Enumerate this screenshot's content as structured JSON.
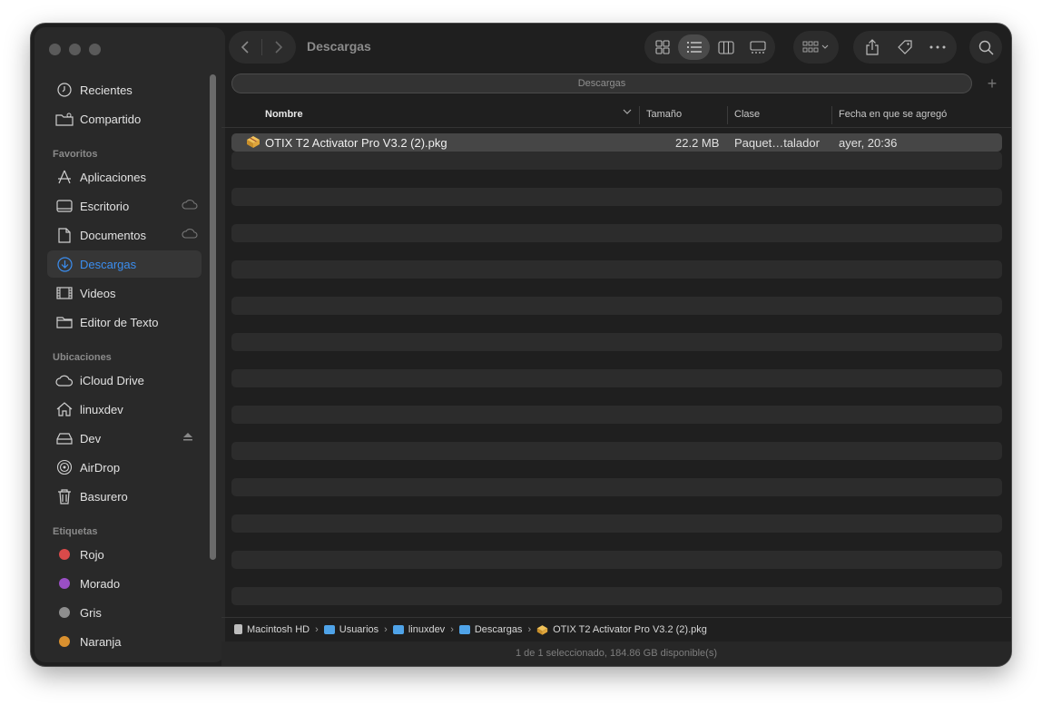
{
  "window": {
    "title": "Descargas"
  },
  "sidebar": {
    "items_top": [
      {
        "label": "Recientes",
        "icon": "clock-icon"
      },
      {
        "label": "Compartido",
        "icon": "shared-folder-icon"
      }
    ],
    "favorites_header": "Favoritos",
    "favorites": [
      {
        "label": "Aplicaciones",
        "icon": "applications-icon"
      },
      {
        "label": "Escritorio",
        "icon": "desktop-icon",
        "trail": "cloud-icon"
      },
      {
        "label": "Documentos",
        "icon": "document-icon",
        "trail": "cloud-icon"
      },
      {
        "label": "Descargas",
        "icon": "download-icon",
        "active": true
      },
      {
        "label": "Videos",
        "icon": "film-icon"
      },
      {
        "label": "Editor de Texto",
        "icon": "folder-icon"
      }
    ],
    "locations_header": "Ubicaciones",
    "locations": [
      {
        "label": "iCloud Drive",
        "icon": "cloud-icon"
      },
      {
        "label": "linuxdev",
        "icon": "home-icon"
      },
      {
        "label": "Dev",
        "icon": "drive-icon",
        "trail": "eject-icon"
      },
      {
        "label": "AirDrop",
        "icon": "airdrop-icon"
      },
      {
        "label": "Basurero",
        "icon": "trash-icon"
      }
    ],
    "tags_header": "Etiquetas",
    "tags": [
      {
        "label": "Rojo",
        "color": "#d94a4a"
      },
      {
        "label": "Morado",
        "color": "#9a4fc5"
      },
      {
        "label": "Gris",
        "color": "#8e8e8e"
      },
      {
        "label": "Naranja",
        "color": "#d9902f"
      }
    ]
  },
  "pathbar": {
    "label": "Descargas"
  },
  "columns": {
    "name": "Nombre",
    "size": "Tamaño",
    "kind": "Clase",
    "date_added": "Fecha en que se agregó"
  },
  "files": [
    {
      "name": "OTIX T2 Activator Pro V3.2 (2).pkg",
      "size": "22.2 MB",
      "kind": "Paquet…talador",
      "date_added": "ayer, 20:36",
      "icon": "package-icon"
    }
  ],
  "breadcrumb": [
    {
      "label": "Macintosh HD",
      "icon": "disk-icon"
    },
    {
      "label": "Usuarios",
      "icon": "folder-icon"
    },
    {
      "label": "linuxdev",
      "icon": "folder-icon"
    },
    {
      "label": "Descargas",
      "icon": "folder-icon"
    },
    {
      "label": "OTIX T2 Activator Pro V3.2 (2).pkg",
      "icon": "package-icon"
    }
  ],
  "breadcrumb_separator": "›",
  "status": "1 de 1 seleccionado, 184.86 GB disponible(s)",
  "colors": {
    "accent": "#3b8ef0",
    "window_bg": "#1f1f1f",
    "sidebar_bg": "#292929"
  }
}
